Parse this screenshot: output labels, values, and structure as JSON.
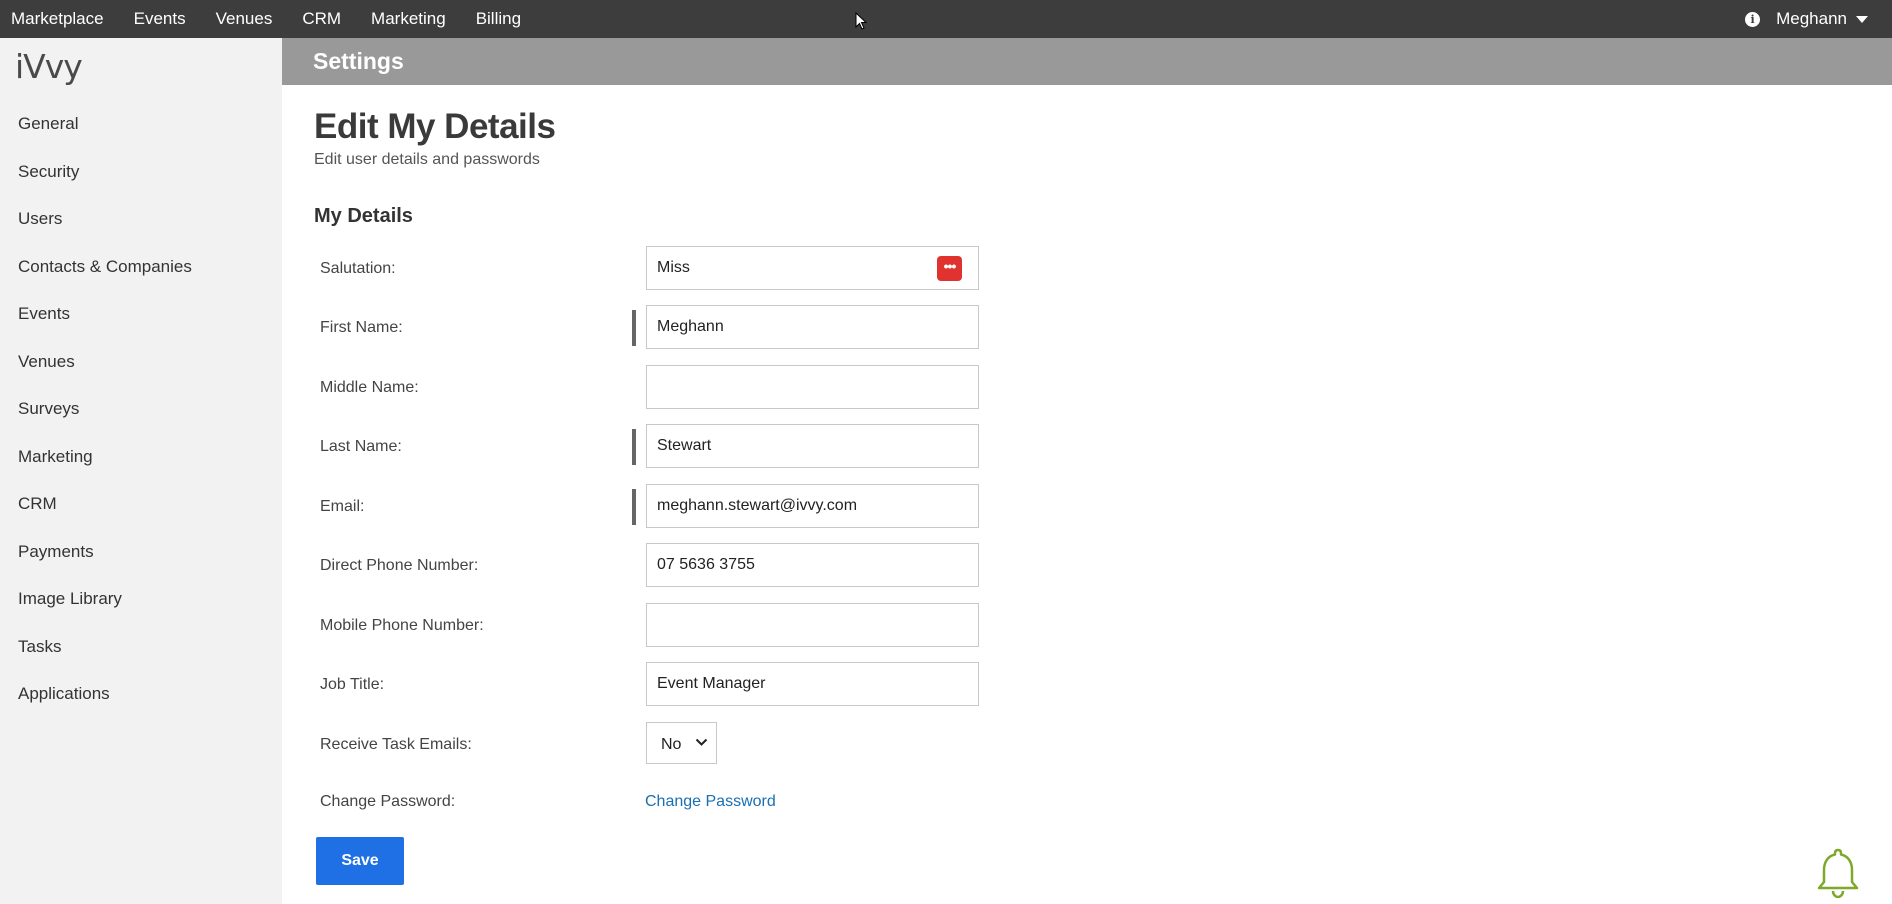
{
  "topnav": {
    "items": [
      {
        "label": "Marketplace"
      },
      {
        "label": "Events"
      },
      {
        "label": "Venues"
      },
      {
        "label": "CRM"
      },
      {
        "label": "Marketing"
      },
      {
        "label": "Billing"
      }
    ],
    "user_name": "Meghann",
    "info_icon": "info-icon"
  },
  "sidebar": {
    "logo": "iVvy",
    "items": [
      {
        "label": "General"
      },
      {
        "label": "Security"
      },
      {
        "label": "Users"
      },
      {
        "label": "Contacts & Companies"
      },
      {
        "label": "Events"
      },
      {
        "label": "Venues"
      },
      {
        "label": "Surveys"
      },
      {
        "label": "Marketing"
      },
      {
        "label": "CRM"
      },
      {
        "label": "Payments"
      },
      {
        "label": "Image Library"
      },
      {
        "label": "Tasks"
      },
      {
        "label": "Applications"
      }
    ]
  },
  "header": {
    "title": "Settings"
  },
  "main": {
    "title": "Edit My Details",
    "subtitle": "Edit user details and passwords",
    "section_title": "My Details",
    "form": {
      "salutation": {
        "label": "Salutation:",
        "value": "Miss"
      },
      "first_name": {
        "label": "First Name:",
        "value": "Meghann"
      },
      "middle_name": {
        "label": "Middle Name:",
        "value": ""
      },
      "last_name": {
        "label": "Last Name:",
        "value": "Stewart"
      },
      "email": {
        "label": "Email:",
        "value": "meghann.stewart@ivvy.com"
      },
      "direct_phone": {
        "label": "Direct Phone Number:",
        "value": "07 5636 3755"
      },
      "mobile_phone": {
        "label": "Mobile Phone Number:",
        "value": ""
      },
      "job_title": {
        "label": "Job Title:",
        "value": "Event Manager"
      },
      "task_emails": {
        "label": "Receive Task Emails:",
        "value": "No"
      },
      "change_password": {
        "label": "Change Password:",
        "link": "Change Password"
      }
    },
    "save_label": "Save"
  },
  "colors": {
    "topbar": "#3d3d3d",
    "settings_bar": "#999999",
    "sidebar": "#f2f2f2",
    "save_button": "#1f6fe5",
    "link": "#1a6fb0",
    "password_manager_icon": "#e0322e"
  }
}
